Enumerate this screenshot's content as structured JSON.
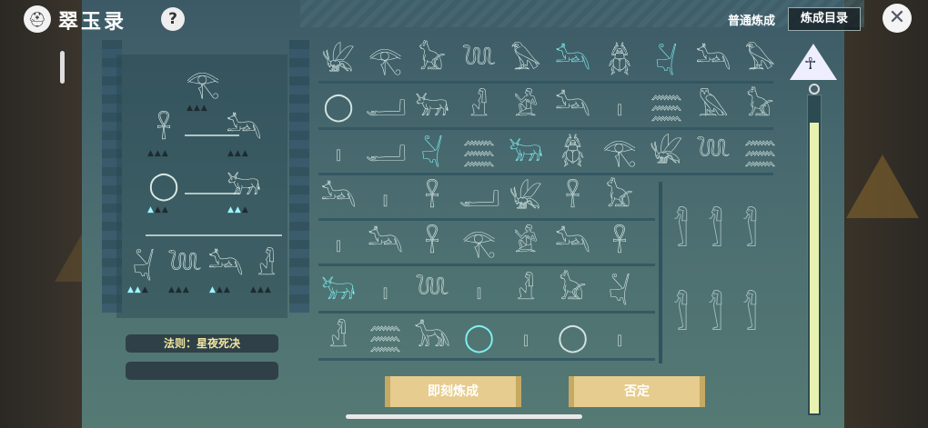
{
  "header": {
    "logo_icon": "helmet-logo-icon",
    "title": "翠玉录",
    "help_label": "?",
    "mode_normal": "普通炼成",
    "mode_catalog": "炼成目录",
    "close_icon": "close-x-icon"
  },
  "recipe": {
    "rule_text": "法则：星夜死决",
    "slots": [
      {
        "glyph": "𓂀",
        "highlight": false,
        "markers": [
          0,
          0,
          0
        ]
      },
      {
        "glyph": "𓋹",
        "highlight": false,
        "markers": [
          0,
          0,
          0
        ]
      },
      {
        "glyph": "𓃢",
        "highlight": false,
        "markers": [
          0,
          0,
          0
        ]
      },
      {
        "glyph": "◯",
        "highlight": false,
        "markers": [
          1,
          0,
          0
        ]
      },
      {
        "glyph": "𓃒",
        "highlight": false,
        "markers": [
          1,
          1,
          0
        ]
      },
      {
        "glyph": "𓋔",
        "highlight": false,
        "markers": [
          1,
          1,
          0
        ]
      },
      {
        "glyph": "𓆙",
        "highlight": false,
        "markers": [
          0,
          0,
          0
        ]
      },
      {
        "glyph": "𓃢",
        "highlight": false,
        "markers": [
          1,
          0,
          0
        ]
      },
      {
        "glyph": "𓁐",
        "highlight": false,
        "markers": [
          0,
          0,
          0
        ]
      }
    ]
  },
  "glyph_grid": {
    "rows": [
      [
        {
          "g": "𓆤",
          "h": false
        },
        {
          "g": "𓂀",
          "h": false
        },
        {
          "g": "𓃠",
          "h": false
        },
        {
          "g": "𓆙",
          "h": false
        },
        {
          "g": "𓅃",
          "h": false
        },
        {
          "g": "𓃢",
          "h": true
        },
        {
          "g": "𓆣",
          "h": false
        },
        {
          "g": "𓋔",
          "h": true
        },
        {
          "g": "𓃢",
          "h": false
        },
        {
          "g": "𓅃",
          "h": false
        }
      ],
      [
        {
          "g": "◯",
          "h": false
        },
        {
          "g": "𓂝",
          "h": false
        },
        {
          "g": "𓃒",
          "h": false
        },
        {
          "g": "𓁐",
          "h": false
        },
        {
          "g": "𓀀",
          "h": false
        },
        {
          "g": "𓃢",
          "h": false
        },
        {
          "g": "𓏤",
          "h": false
        },
        {
          "g": "𓈗",
          "h": false
        },
        {
          "g": "𓅓",
          "h": false
        },
        {
          "g": "𓃠",
          "h": false
        }
      ],
      [
        {
          "g": "𓏤",
          "h": false
        },
        {
          "g": "𓂝",
          "h": false
        },
        {
          "g": "𓋔",
          "h": true
        },
        {
          "g": "𓈗",
          "h": false
        },
        {
          "g": "𓃒",
          "h": true
        },
        {
          "g": "𓆣",
          "h": false
        },
        {
          "g": "𓂀",
          "h": false
        },
        {
          "g": "𓆤",
          "h": false
        },
        {
          "g": "𓆙",
          "h": false
        },
        {
          "g": "𓈗",
          "h": false
        }
      ],
      [
        {
          "g": "𓃢",
          "h": false
        },
        {
          "g": "𓏤",
          "h": false
        },
        {
          "g": "𓋹",
          "h": false
        },
        {
          "g": "𓂝",
          "h": false
        },
        {
          "g": "𓆤",
          "h": false
        },
        {
          "g": "𓋹",
          "h": false
        },
        {
          "g": "𓃠",
          "h": false
        }
      ],
      [
        {
          "g": "𓏤",
          "h": false
        },
        {
          "g": "𓃢",
          "h": false
        },
        {
          "g": "𓋹",
          "h": false
        },
        {
          "g": "𓂀",
          "h": false
        },
        {
          "g": "𓀀",
          "h": false
        },
        {
          "g": "𓃢",
          "h": false
        },
        {
          "g": "𓋹",
          "h": false
        }
      ],
      [
        {
          "g": "𓃒",
          "h": true
        },
        {
          "g": "𓏤",
          "h": false
        },
        {
          "g": "𓆙",
          "h": false
        },
        {
          "g": "𓏤",
          "h": false
        },
        {
          "g": "𓁐",
          "h": false
        },
        {
          "g": "𓃠",
          "h": false
        },
        {
          "g": "𓋔",
          "h": false
        }
      ],
      [
        {
          "g": "𓁐",
          "h": false
        },
        {
          "g": "𓈗",
          "h": false
        },
        {
          "g": "𓃥",
          "h": false
        },
        {
          "g": "◯",
          "h": true
        },
        {
          "g": "𓏤",
          "h": false
        },
        {
          "g": "◯",
          "h": false
        },
        {
          "g": "𓏤",
          "h": false
        }
      ]
    ],
    "statues": [
      "𓀾",
      "𓀾",
      "𓀾",
      "𓀾",
      "𓀾",
      "𓀾"
    ]
  },
  "actions": {
    "confirm_label": "即刻炼成",
    "reject_label": "否定"
  },
  "gauge": {
    "icon": "ankh-icon",
    "glyph": "☥",
    "level_fraction": 0.92
  }
}
